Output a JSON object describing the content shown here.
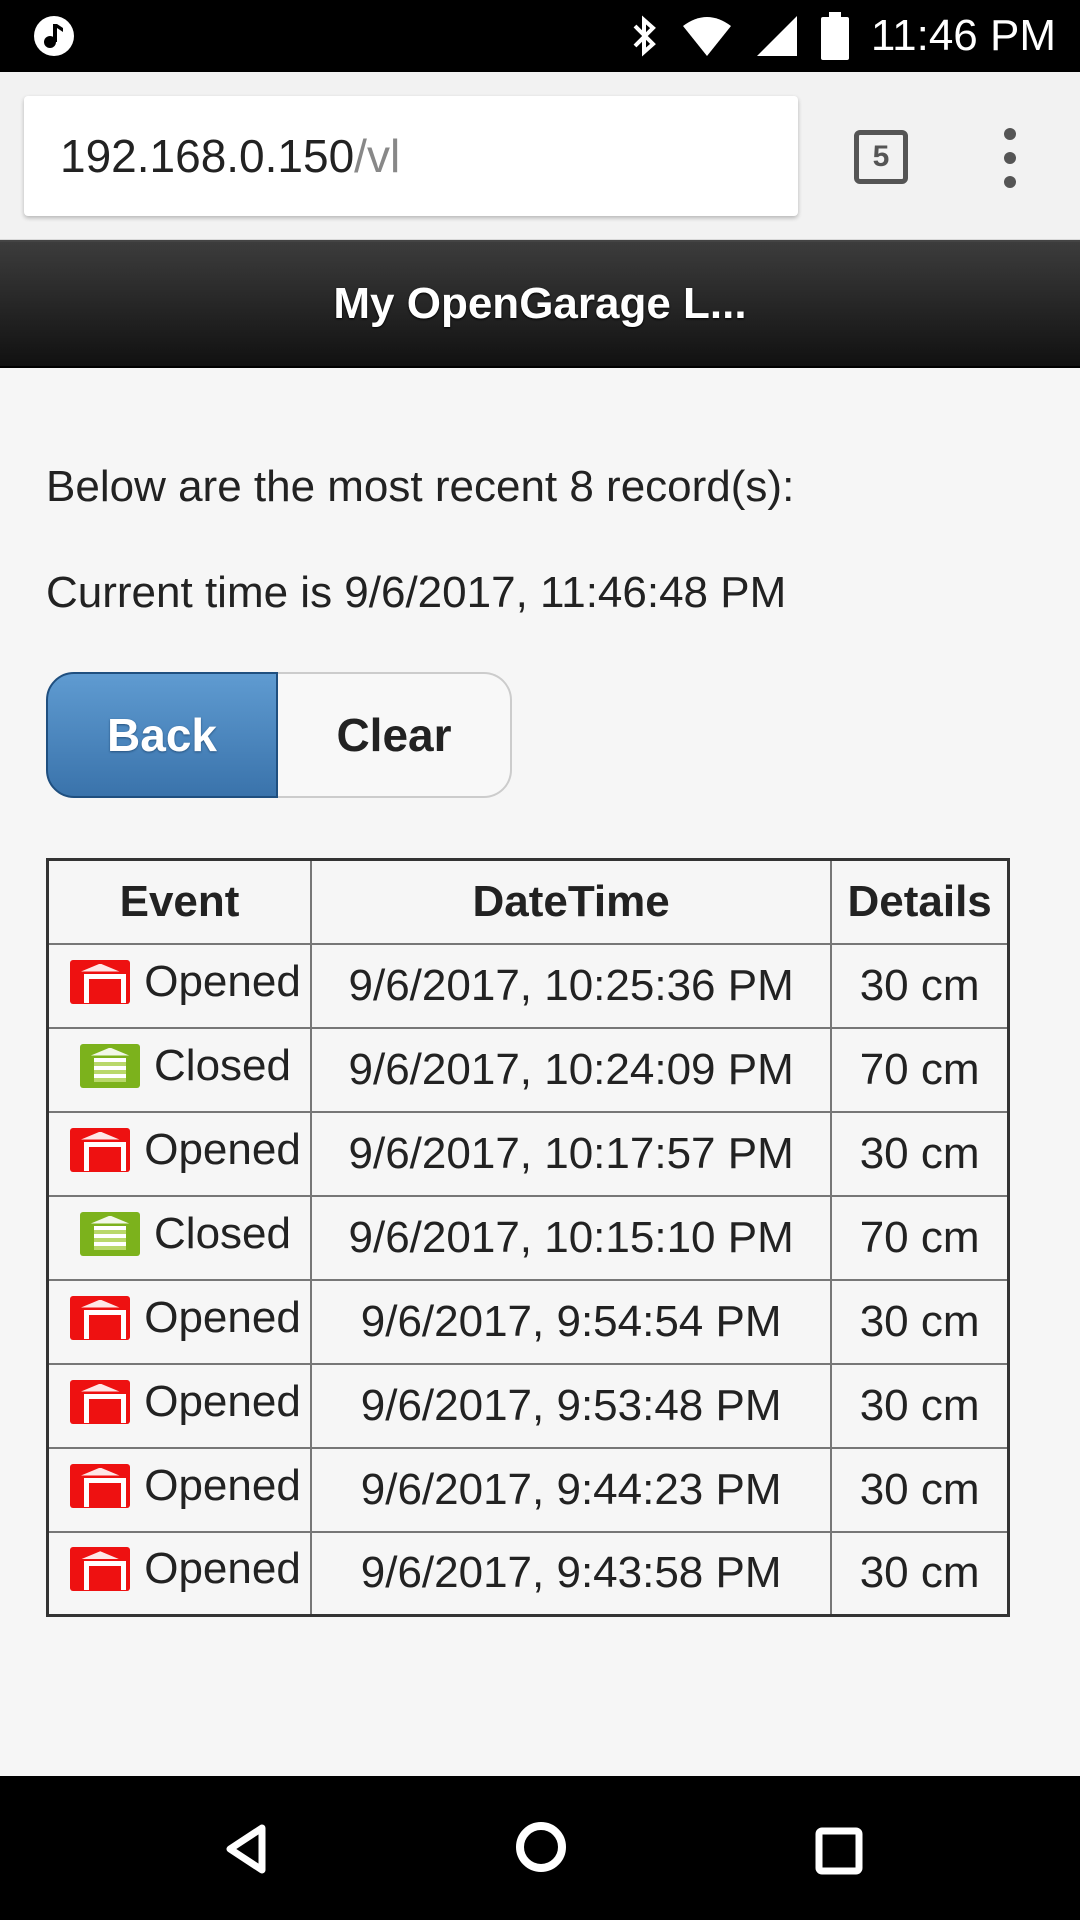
{
  "status_bar": {
    "time": "11:46 PM",
    "icons": [
      "music-note-icon",
      "bluetooth-icon",
      "wifi-icon",
      "signal-icon",
      "battery-icon"
    ]
  },
  "browser": {
    "url_host": "192.168.0.150",
    "url_path": "/vl",
    "tab_count": "5",
    "menu_icon": "more-vert-icon"
  },
  "page": {
    "title": "My OpenGarage L...",
    "records_text": "Below are the most recent 8 record(s):",
    "current_time_text": "Current time is 9/6/2017, 11:46:48 PM",
    "back_label": "Back",
    "clear_label": "Clear"
  },
  "log_table": {
    "headers": [
      "Event",
      "DateTime",
      "Details"
    ],
    "rows": [
      {
        "event": "Opened",
        "status": "opened",
        "datetime": "9/6/2017, 10:25:36 PM",
        "details": "30 cm"
      },
      {
        "event": "Closed",
        "status": "closed",
        "datetime": "9/6/2017, 10:24:09 PM",
        "details": "70 cm"
      },
      {
        "event": "Opened",
        "status": "opened",
        "datetime": "9/6/2017, 10:17:57 PM",
        "details": "30 cm"
      },
      {
        "event": "Closed",
        "status": "closed",
        "datetime": "9/6/2017, 10:15:10 PM",
        "details": "70 cm"
      },
      {
        "event": "Opened",
        "status": "opened",
        "datetime": "9/6/2017, 9:54:54 PM",
        "details": "30 cm"
      },
      {
        "event": "Opened",
        "status": "opened",
        "datetime": "9/6/2017, 9:53:48 PM",
        "details": "30 cm"
      },
      {
        "event": "Opened",
        "status": "opened",
        "datetime": "9/6/2017, 9:44:23 PM",
        "details": "30 cm"
      },
      {
        "event": "Opened",
        "status": "opened",
        "datetime": "9/6/2017, 9:43:58 PM",
        "details": "30 cm"
      }
    ]
  },
  "colors": {
    "opened": "#ee1111",
    "closed": "#7cb21c",
    "back_button": "#4a85bf",
    "header_bg": "#222222"
  },
  "nav_bar": {
    "icons": [
      "nav-back-icon",
      "nav-home-icon",
      "nav-recents-icon"
    ]
  }
}
